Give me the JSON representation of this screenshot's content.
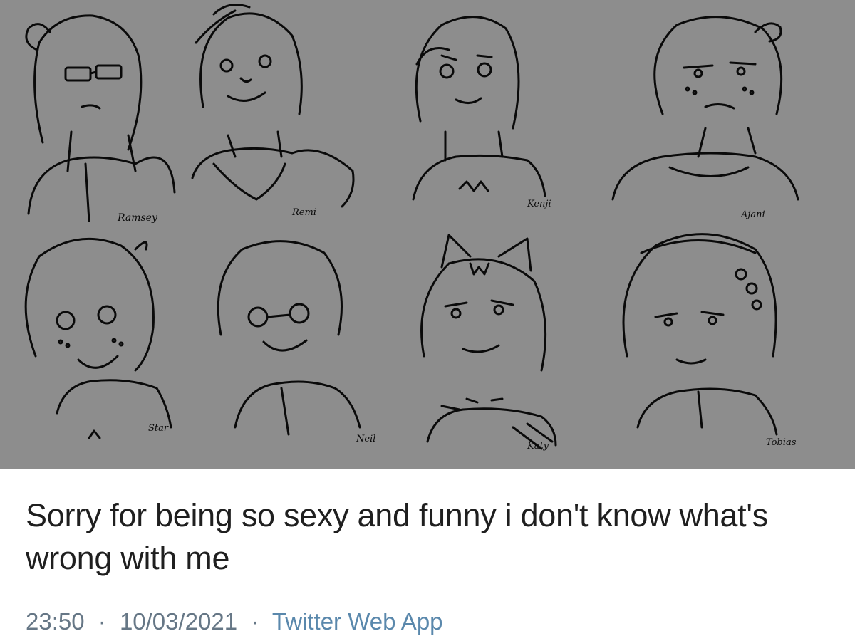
{
  "artwork": {
    "sketches": [
      {
        "signature": "Ramsey"
      },
      {
        "signature": "Remi"
      },
      {
        "signature": "Kenji"
      },
      {
        "signature": "Ajani"
      },
      {
        "signature": "Star"
      },
      {
        "signature": "Neil"
      },
      {
        "signature": "Katy"
      },
      {
        "signature": "Tobias"
      }
    ]
  },
  "tweet": {
    "text": "Sorry for being so sexy and funny i don't know what's wrong with me",
    "time": "23:50",
    "date": "10/03/2021",
    "separator": "·",
    "source": "Twitter Web App"
  },
  "colors": {
    "art_background": "#8d8d8d",
    "line_art": "#0a0a0a",
    "text": "#1f1f1f",
    "meta": "#667786",
    "source_link": "#5a88ac"
  }
}
